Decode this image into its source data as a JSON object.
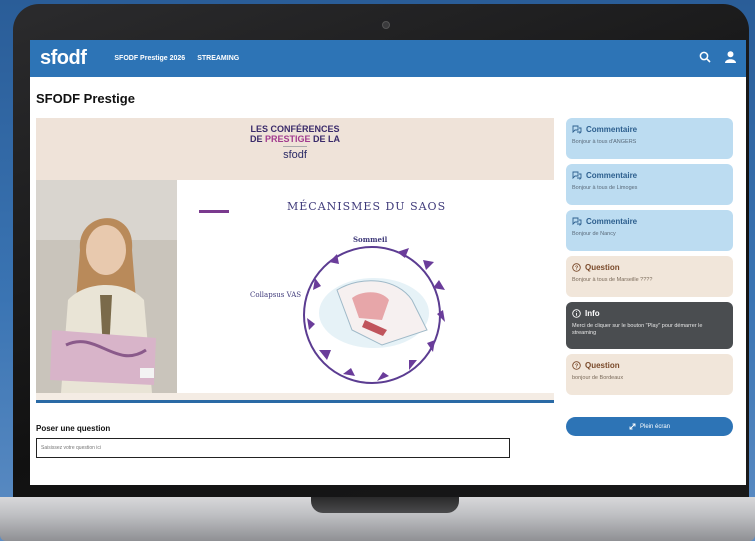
{
  "header": {
    "logo": "sfodf",
    "nav": [
      "SFODF Prestige 2026",
      "STREAMING"
    ],
    "search_icon": "search-icon",
    "user_icon": "user-icon"
  },
  "page": {
    "title": "SFODF Prestige"
  },
  "video": {
    "logo_line1": "LES CONFÉRENCES",
    "logo_line2a": "DE",
    "logo_line2b": "PRESTIGE",
    "logo_line2c": "DE LA",
    "logo_sfodf": "sfodf",
    "slide_title": "MÉCANISMES DU SAOS",
    "label_top": "Sommeil",
    "label_left": "Collapsus VAS"
  },
  "question": {
    "label": "Poser une question",
    "placeholder": "Saisissez votre question ici"
  },
  "sidebar": {
    "cards": [
      {
        "type": "comment",
        "title": "Commentaire",
        "body": "Bonjour à tous d'ANGERS"
      },
      {
        "type": "comment",
        "title": "Commentaire",
        "body": "Bonjour à tous de Limoges"
      },
      {
        "type": "comment",
        "title": "Commentaire",
        "body": "Bonjour de Nancy"
      },
      {
        "type": "question",
        "title": "Question",
        "body": "Bonjour à tous de Marseille ????"
      },
      {
        "type": "info",
        "title": "Info",
        "body": "Merci de cliquer sur le bouton \"Play\" pour démarrer le streaming"
      },
      {
        "type": "question",
        "title": "Question",
        "body": "bonjour de Bordeaux"
      }
    ],
    "fullscreen_label": "Plein écran"
  }
}
